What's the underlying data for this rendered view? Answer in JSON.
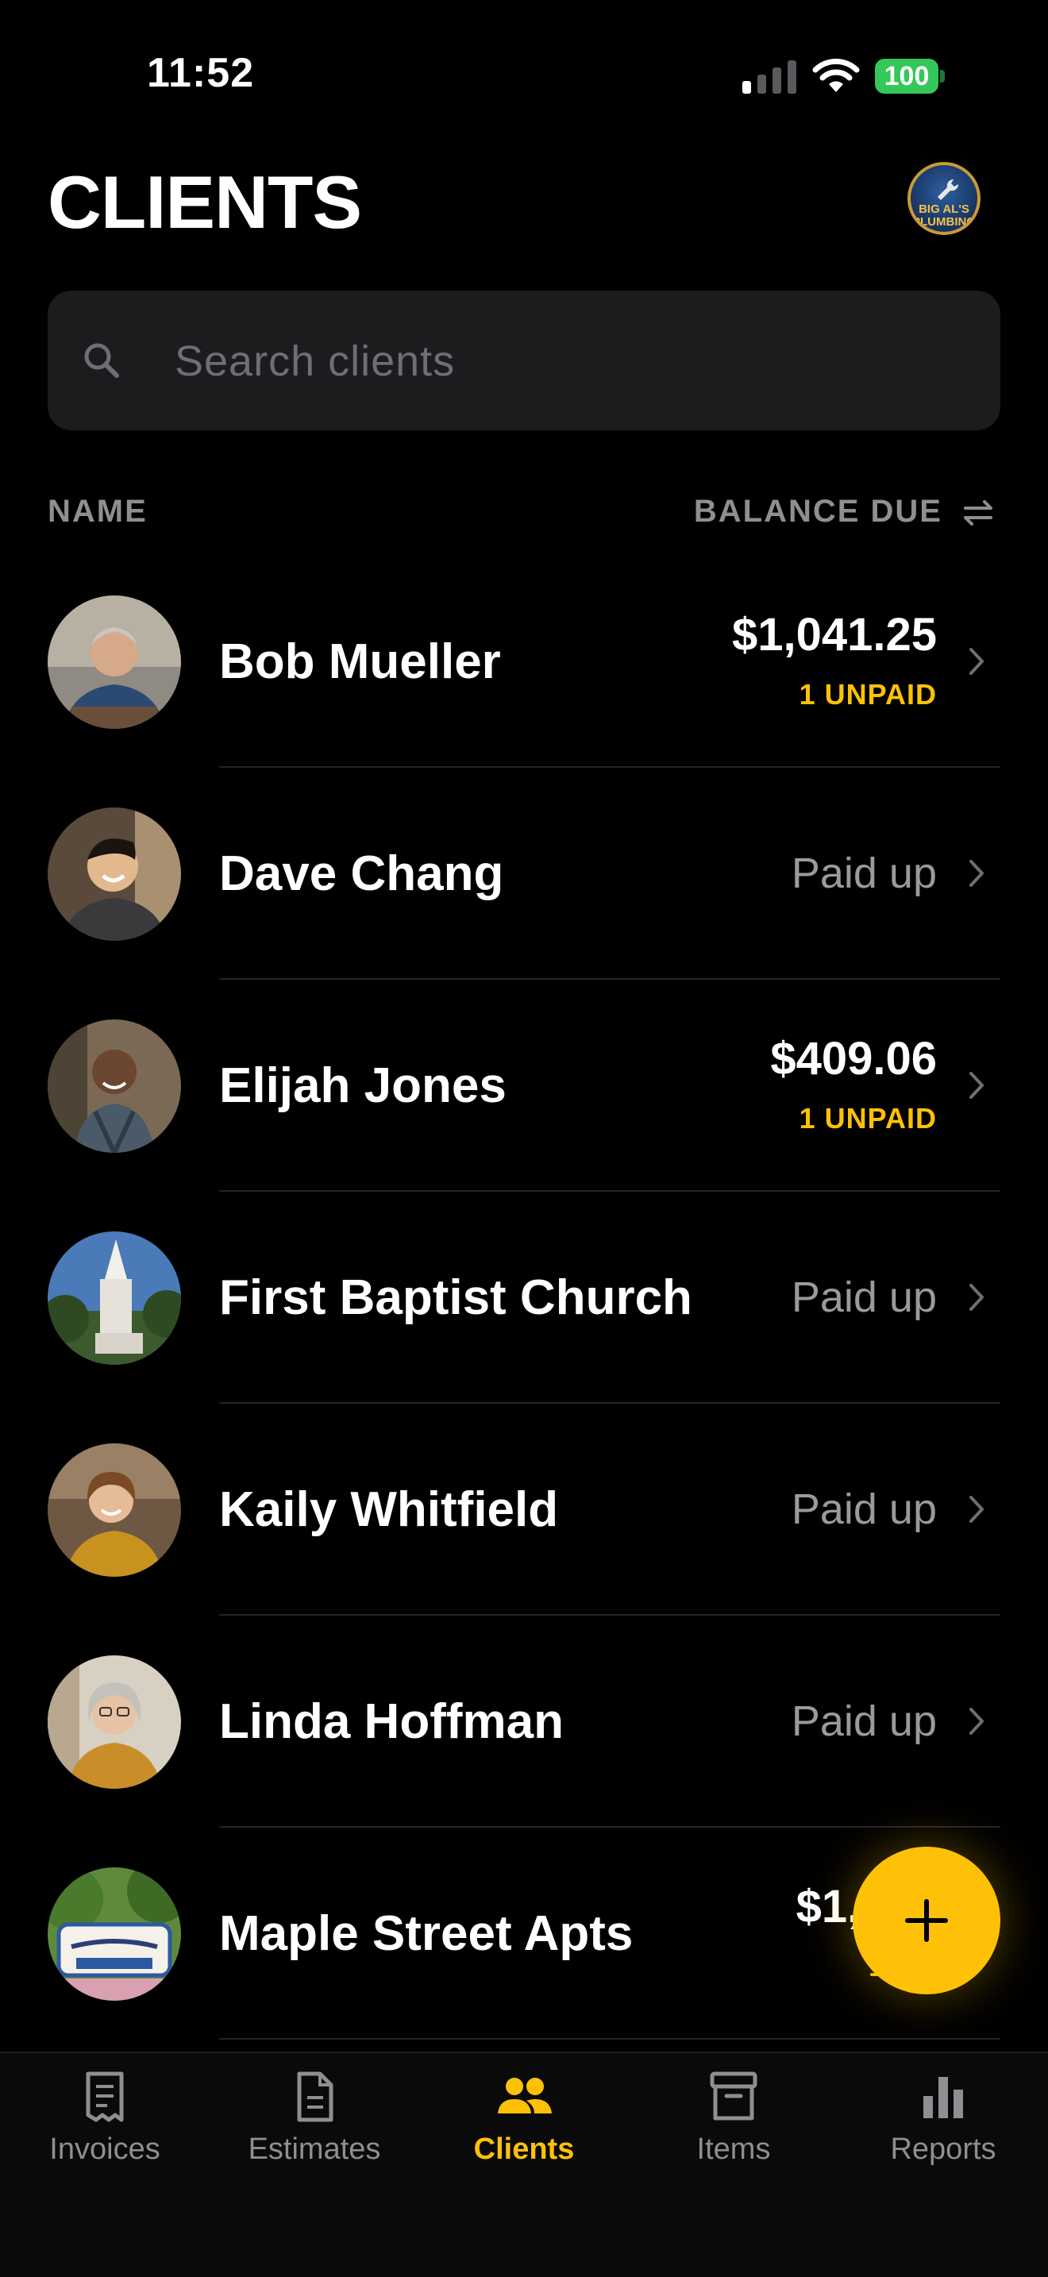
{
  "status_bar": {
    "time": "11:52",
    "battery": "100"
  },
  "header": {
    "title": "CLIENTS",
    "logo_text": "BIG AL'S PLUMBING"
  },
  "search": {
    "placeholder": "Search clients",
    "value": ""
  },
  "columns": {
    "name": "NAME",
    "balance": "BALANCE DUE"
  },
  "clients": [
    {
      "name": "Bob Mueller",
      "amount": "$1,041.25",
      "status": "1 UNPAID"
    },
    {
      "name": "Dave Chang",
      "status": "Paid up"
    },
    {
      "name": "Elijah Jones",
      "amount": "$409.06",
      "status": "1 UNPAID"
    },
    {
      "name": "First Baptist Church",
      "status": "Paid up"
    },
    {
      "name": "Kaily Whitfield",
      "status": "Paid up"
    },
    {
      "name": "Linda Hoffman",
      "status": "Paid up"
    },
    {
      "name": "Maple Street Apts",
      "amount": "$1,423",
      "status": "1 UN"
    }
  ],
  "tabs": [
    {
      "label": "Invoices",
      "icon": "receipt-icon"
    },
    {
      "label": "Estimates",
      "icon": "document-icon"
    },
    {
      "label": "Clients",
      "icon": "people-icon",
      "active": true
    },
    {
      "label": "Items",
      "icon": "archive-box-icon"
    },
    {
      "label": "Reports",
      "icon": "bar-chart-icon"
    }
  ],
  "colors": {
    "accent": "#ffc107",
    "background": "#000000",
    "battery": "#34c759"
  }
}
